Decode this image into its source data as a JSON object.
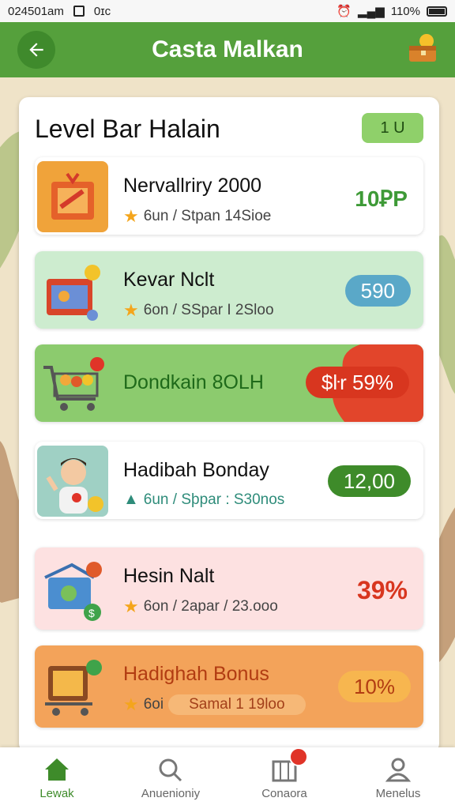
{
  "status_bar": {
    "time": "024501am",
    "carrier": "0ɪc",
    "battery": "110%"
  },
  "header": {
    "title": "Casta Malkan"
  },
  "card": {
    "title": "Level Bar Halain",
    "badge": "1 U",
    "items": [
      {
        "name": "Nervallriry 2000",
        "meta": "6un / Stpan 14Sioe",
        "value": "10ꝐP"
      },
      {
        "name": "Kevar Nclt",
        "meta": "6on / SSpar I 2Sloo",
        "value": "590"
      },
      {
        "name": "Dondkain 8OLH",
        "value": "$ŀr 59%"
      },
      {
        "name": "Hadibah Bonday",
        "meta": "6un / Sþpar : S30nos",
        "value": "12,00"
      },
      {
        "name": "Hesin Nalt",
        "meta": "6on / 2apar / 23.ooo",
        "value": "39%"
      },
      {
        "name": "Hadighah Bonus",
        "meta_prefix": "6oi",
        "meta": "Samal 1 19loo",
        "value": "10%"
      }
    ]
  },
  "tabs": [
    {
      "label": "Lewak",
      "icon": "home-icon"
    },
    {
      "label": "Anuenioniy",
      "icon": "search-icon"
    },
    {
      "label": "Conaora",
      "icon": "shop-icon"
    },
    {
      "label": "Menelus",
      "icon": "person-icon"
    }
  ],
  "colors": {
    "appbar": "#55a03c",
    "accent_green": "#4a9a36",
    "accent_red": "#e0412b",
    "accent_orange": "#ef9b3f",
    "accent_blue": "#5aa8c8"
  }
}
